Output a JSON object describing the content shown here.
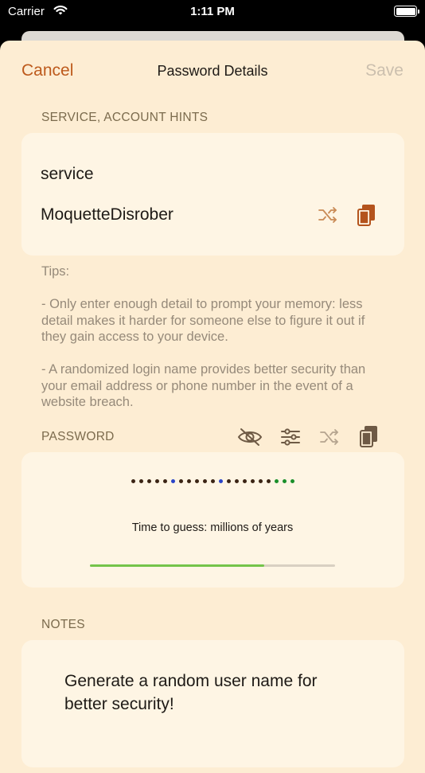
{
  "status_bar": {
    "carrier": "Carrier",
    "time": "1:11 PM"
  },
  "nav": {
    "cancel": "Cancel",
    "title": "Password Details",
    "save": "Save"
  },
  "service_section": {
    "header": "SERVICE, ACCOUNT HINTS",
    "service": "service",
    "account": "MoquetteDisrober"
  },
  "tips": "Tips:\n\n- Only enter enough detail to prompt your memory: less detail makes it harder for someone else to figure it out if they gain access to your device.\n\n- A randomized login name provides better security than your email address or phone number in the event of a website breach.",
  "password_section": {
    "header": "PASSWORD",
    "dot_colors": [
      "#3b2414",
      "#3b2414",
      "#3b2414",
      "#3b2414",
      "#3b2414",
      "#2a44c8",
      "#3b2414",
      "#3b2414",
      "#3b2414",
      "#3b2414",
      "#3b2414",
      "#2a44c8",
      "#3b2414",
      "#3b2414",
      "#3b2414",
      "#3b2414",
      "#3b2414",
      "#3b2414",
      "#1a8f2a",
      "#1a8f2a",
      "#1a8f2a"
    ],
    "time_to_guess": "Time to guess: millions of years",
    "strength_fraction": 0.71
  },
  "notes_section": {
    "header": "NOTES",
    "text": "Generate a random user name for\nbetter security!"
  },
  "colors": {
    "accent": "#bd5a1c",
    "sheet": "#fdedd3",
    "card": "#fef5e4",
    "icon": "#c98a55"
  }
}
